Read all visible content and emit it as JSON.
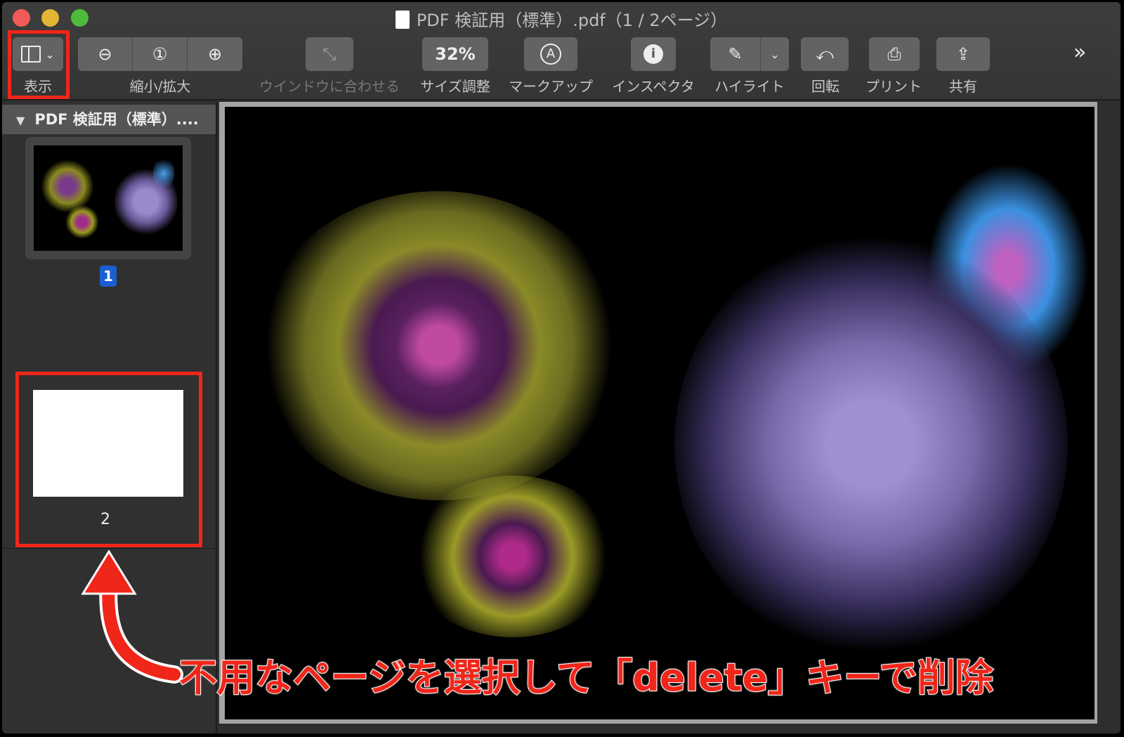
{
  "window": {
    "title": "PDF 検証用（標準）.pdf（1 / 2ページ）"
  },
  "toolbar": {
    "view_label": "表示",
    "zoom_label": "縮小/拡大",
    "fit_label": "ウインドウに合わせる",
    "size_value": "32%",
    "size_label": "サイズ調整",
    "markup_label": "マークアップ",
    "inspector_label": "インスペクタ",
    "highlight_label": "ハイライト",
    "rotate_label": "回転",
    "print_label": "プリント",
    "share_label": "共有",
    "overflow": "»"
  },
  "sidebar": {
    "header": "PDF 検証用（標準）....",
    "pages": [
      {
        "number": "1"
      },
      {
        "number": "2"
      }
    ]
  },
  "annotation": {
    "text": "不用なページを選択して「delete」キーで削除"
  },
  "colors": {
    "accent": "#f0261b",
    "selection": "#1a5fd0"
  }
}
